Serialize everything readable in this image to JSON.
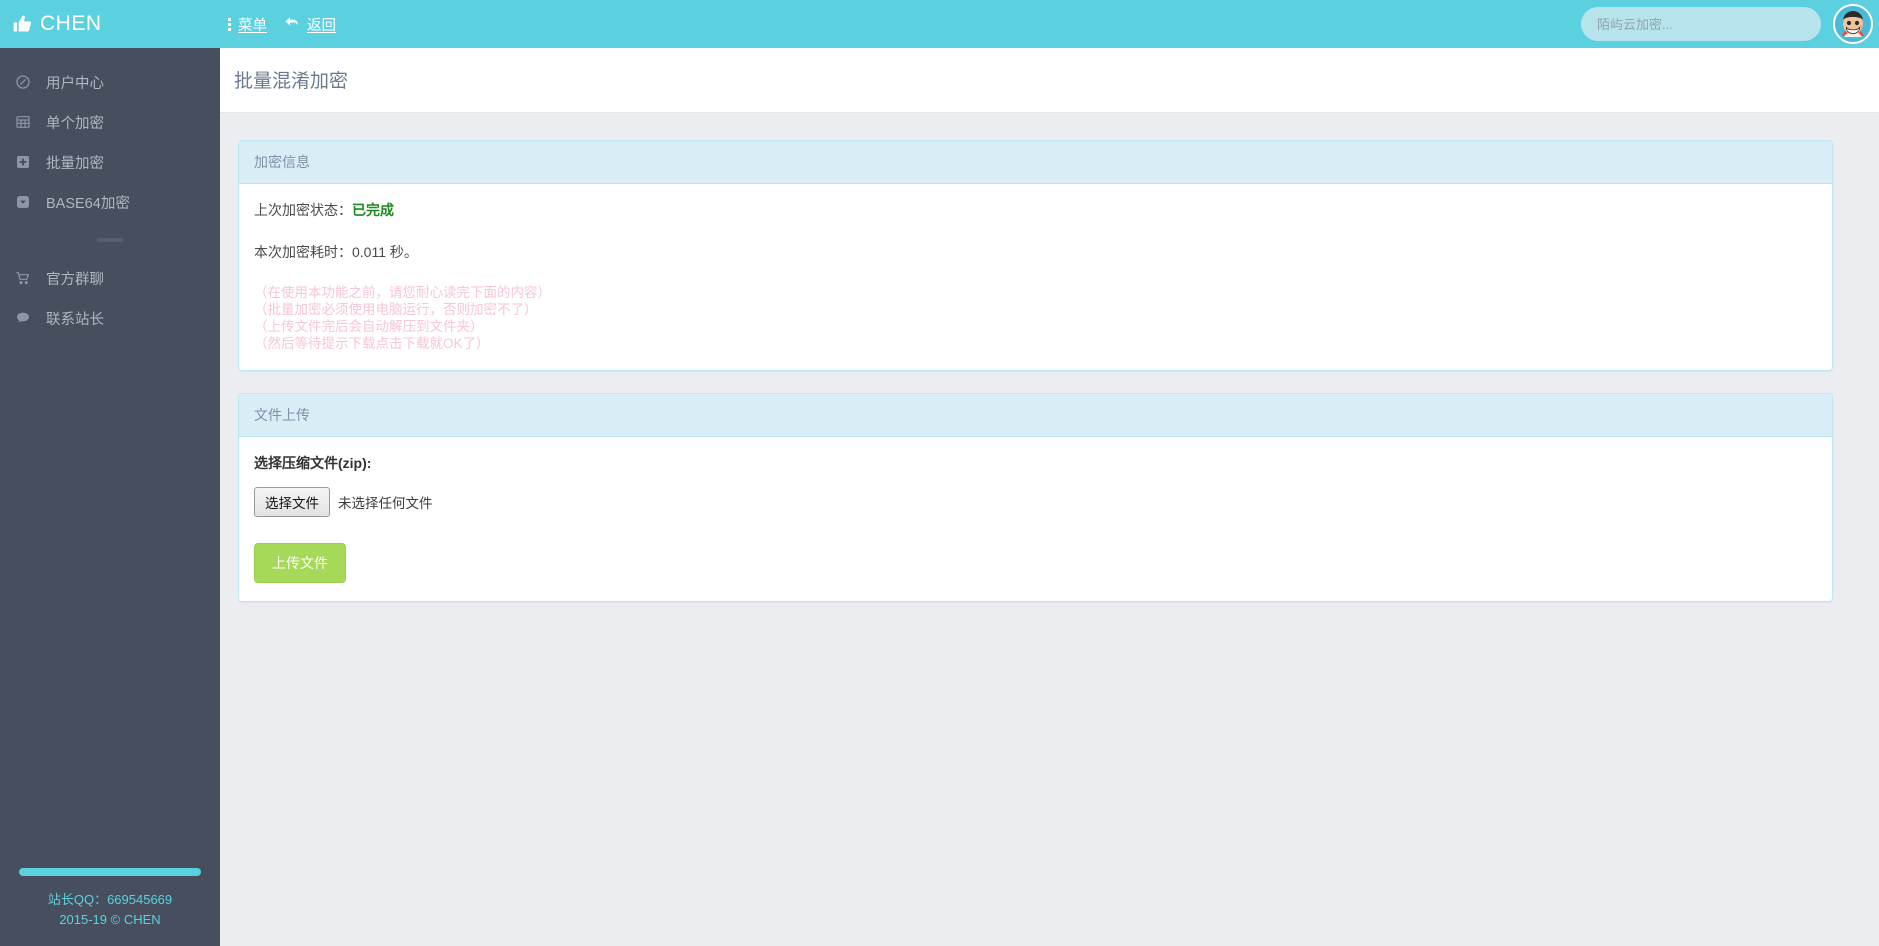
{
  "header": {
    "brand": "CHEN",
    "brand_icon": "thumbs-up-icon",
    "menu_label": "菜单",
    "back_label": "返回",
    "search_placeholder": "陌屿云加密...",
    "search_value": "",
    "avatar_alt": "user-avatar",
    "bar_color": "#5bd1e0"
  },
  "sidebar": {
    "items": [
      {
        "label": "用户中心",
        "icon": "compass-icon"
      },
      {
        "label": "单个加密",
        "icon": "table-grid-icon"
      },
      {
        "label": "批量加密",
        "icon": "plus-square-icon"
      },
      {
        "label": "BASE64加密",
        "icon": "chevron-down-square-icon"
      }
    ],
    "items_bottom": [
      {
        "label": "官方群聊",
        "icon": "shopping-cart-icon"
      },
      {
        "label": "联系站长",
        "icon": "chat-bubble-icon"
      }
    ],
    "footer": {
      "qq_line": "站长QQ：669545669",
      "copyright": "2015-19 © CHEN"
    },
    "bg_color": "#474f5e",
    "accent_color": "#5bd1e0"
  },
  "main": {
    "page_title": "批量混淆加密",
    "info_panel": {
      "title": "加密信息",
      "status_label": "上次加密状态：",
      "status_value": "已完成",
      "status_color": "#1f8a1f",
      "time_line": "本次加密耗时：0.011 秒。",
      "notes": [
        "（在使用本功能之前，请您耐心读完下面的内容）",
        "（批量加密必须使用电脑运行，否则加密不了）",
        "（上传文件完后会自动解压到文件夹）",
        "（然后等待提示下载点击下载就OK了）"
      ],
      "notes_color": "#f7c6d5"
    },
    "upload_panel": {
      "title": "文件上传",
      "field_label": "选择压缩文件(zip):",
      "choose_button": "选择文件",
      "no_file_text": "未选择任何文件",
      "submit_button": "上传文件",
      "submit_color": "#a6d957"
    }
  }
}
